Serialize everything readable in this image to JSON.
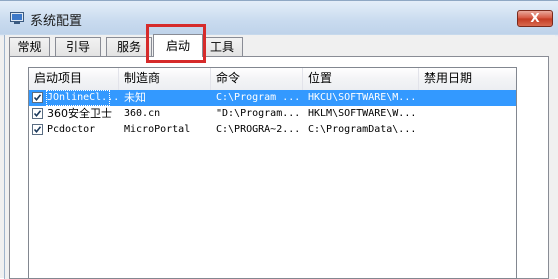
{
  "window": {
    "title": "系统配置",
    "close_label": "X",
    "app_icon": "system-config-icon"
  },
  "tabs": [
    {
      "label": "常规"
    },
    {
      "label": "引导"
    },
    {
      "label": "服务"
    },
    {
      "label": "启动",
      "active": true
    },
    {
      "label": "工具"
    }
  ],
  "list": {
    "columns": [
      "启动项目",
      "制造商",
      "命令",
      "位置",
      "禁用日期"
    ],
    "rows": [
      {
        "checked": true,
        "selected": true,
        "item": "JOnlineCl...",
        "maker": "未知",
        "command": "C:\\Program ...",
        "location": "HKCU\\SOFTWARE\\M...",
        "disabled_date": ""
      },
      {
        "checked": true,
        "selected": false,
        "item": "360安全卫士",
        "maker": "360.cn",
        "command": "\"D:\\Program...",
        "location": "HKLM\\SOFTWARE\\W...",
        "disabled_date": ""
      },
      {
        "checked": true,
        "selected": false,
        "item": "Pcdoctor",
        "maker": "MicroPortal",
        "command": "C:\\PROGRA~2...",
        "location": "C:\\ProgramData\\...",
        "disabled_date": ""
      }
    ]
  },
  "colors": {
    "selection": "#3399ff",
    "highlight_box": "#d62b2b",
    "close_button": "#c33a22"
  }
}
